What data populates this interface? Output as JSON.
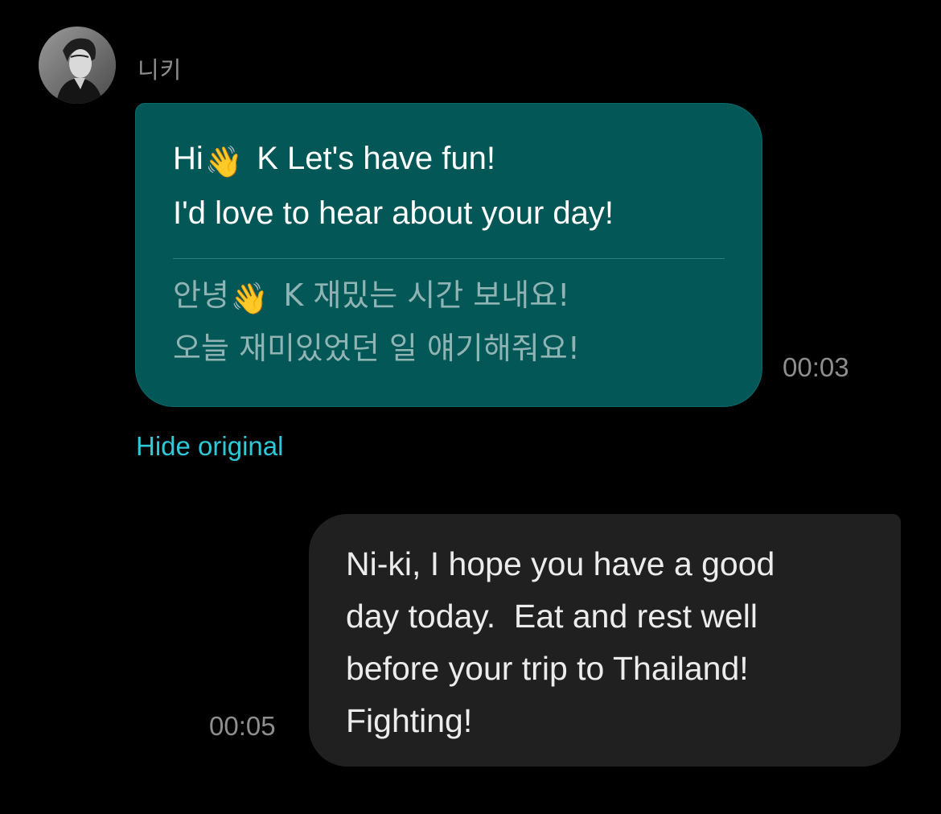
{
  "chat": {
    "sender": {
      "name": "니키",
      "avatar": "profile-photo"
    },
    "incoming": {
      "translated_lines": [
        {
          "before": "Hi",
          "emoji": "👋",
          "after": " K Let's have fun!"
        },
        {
          "text": "I'd love to hear about your day!"
        }
      ],
      "original_lines": [
        {
          "before": "안녕",
          "emoji": "👋",
          "after": " K 재밌는 시간 보내요!"
        },
        {
          "text": "오늘 재미있었던 일 얘기해줘요!"
        }
      ],
      "time": "00:03",
      "toggle_label": "Hide original"
    },
    "outgoing": {
      "lines": [
        "Ni-ki, I hope you have a good",
        "day today.  Eat and rest well",
        "before your trip to Thailand!",
        "Fighting!"
      ],
      "time": "00:05"
    }
  },
  "colors": {
    "background": "#000000",
    "incoming_bubble": "#045757",
    "outgoing_bubble": "#202020",
    "accent_link": "#2ec9d8",
    "timestamp": "#8e8e8e"
  }
}
